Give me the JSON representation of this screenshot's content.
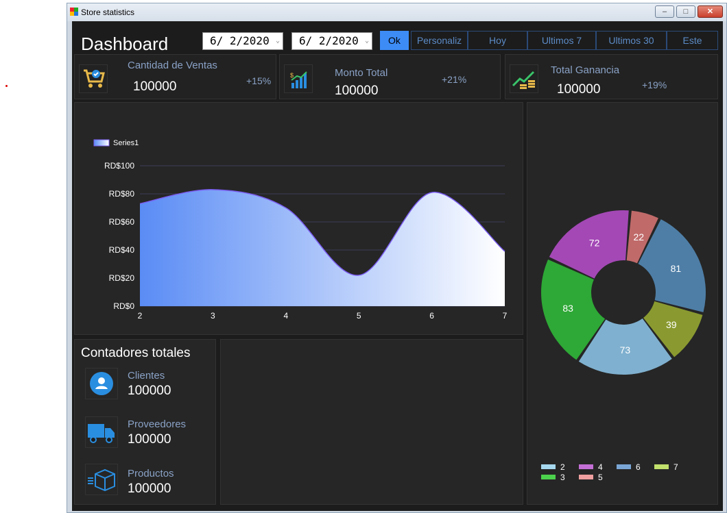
{
  "window": {
    "title": "Store statistics"
  },
  "dashboard": {
    "title": "Dashboard",
    "start_date": "6/ 2/2020",
    "end_date": "6/ 2/2020",
    "buttons": [
      "Ok",
      "Personaliz",
      "Hoy",
      "Ultimos 7",
      "Ultimos 30",
      "Este"
    ]
  },
  "cards": [
    {
      "label": "Cantidad de Ventas",
      "value": "100000",
      "pct": "+15%",
      "icon": "shopping-cart-icon"
    },
    {
      "label": "Monto Total",
      "value": "100000",
      "pct": "+21%",
      "icon": "bar-growth-icon"
    },
    {
      "label": "Total Ganancia",
      "value": "100000",
      "pct": "+19%",
      "icon": "money-growth-icon"
    }
  ],
  "counters": {
    "title": "Contadores totales",
    "items": [
      {
        "label": "Clientes",
        "value": "100000",
        "icon": "user-icon"
      },
      {
        "label": "Proveedores",
        "value": "100000",
        "icon": "truck-icon"
      },
      {
        "label": "Productos",
        "value": "100000",
        "icon": "box-icon"
      }
    ]
  },
  "colors": {
    "accent": "#3d8cf6",
    "background": "#1c1c1c",
    "panel": "#262626",
    "label": "#8aa2c6"
  },
  "chart_data": [
    {
      "type": "area",
      "x": [
        2,
        3,
        4,
        5,
        6,
        7
      ],
      "series": [
        {
          "name": "Series1",
          "values": [
            73,
            83,
            70,
            22,
            81,
            39
          ]
        }
      ],
      "yticks": [
        "RD$0",
        "RD$20",
        "RD$40",
        "RD$60",
        "RD$80",
        "RD$100"
      ],
      "ylim": [
        0,
        100
      ],
      "xlim": [
        2,
        7
      ],
      "grid": true,
      "legend": "top-left"
    },
    {
      "type": "pie",
      "categories": [
        "2",
        "3",
        "4",
        "5",
        "6",
        "7"
      ],
      "values": [
        73,
        83,
        72,
        22,
        81,
        39
      ],
      "colors": [
        "#7fb0cf",
        "#2ea836",
        "#a448b6",
        "#c06a6a",
        "#4e7ea6",
        "#8a9a30"
      ],
      "legend_colors": [
        "#a6d8f0",
        "#4cd14c",
        "#c46fd6",
        "#f0a0a0",
        "#7aa6d6",
        "#c2e06c"
      ],
      "legend": "bottom"
    }
  ]
}
